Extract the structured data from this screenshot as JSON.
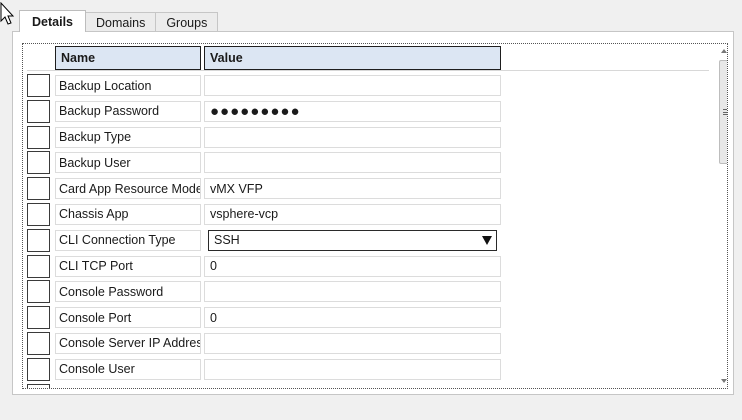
{
  "tabs": [
    {
      "label": "Details",
      "active": true
    },
    {
      "label": "Domains",
      "active": false
    },
    {
      "label": "Groups",
      "active": false
    }
  ],
  "grid": {
    "columns": {
      "name": "Name",
      "value": "Value"
    },
    "rows": [
      {
        "name": "Backup Location",
        "value": ""
      },
      {
        "name": "Backup Password",
        "value": "●●●●●●●●●"
      },
      {
        "name": "Backup Type",
        "value": ""
      },
      {
        "name": "Backup User",
        "value": ""
      },
      {
        "name": "Card App Resource Model",
        "value": "vMX VFP"
      },
      {
        "name": "Chassis App",
        "value": "vsphere-vcp"
      },
      {
        "name": "CLI Connection Type",
        "value": "SSH"
      },
      {
        "name": "CLI TCP Port",
        "value": "0"
      },
      {
        "name": "Console Password",
        "value": ""
      },
      {
        "name": "Console Port",
        "value": "0"
      },
      {
        "name": "Console Server IP Address",
        "value": ""
      },
      {
        "name": "Console User",
        "value": ""
      }
    ]
  },
  "icons": {
    "cursor": "mouse-pointer-icon",
    "scroll_up": "scroll-up-arrow-icon",
    "scroll_down": "scroll-down-arrow-icon"
  }
}
